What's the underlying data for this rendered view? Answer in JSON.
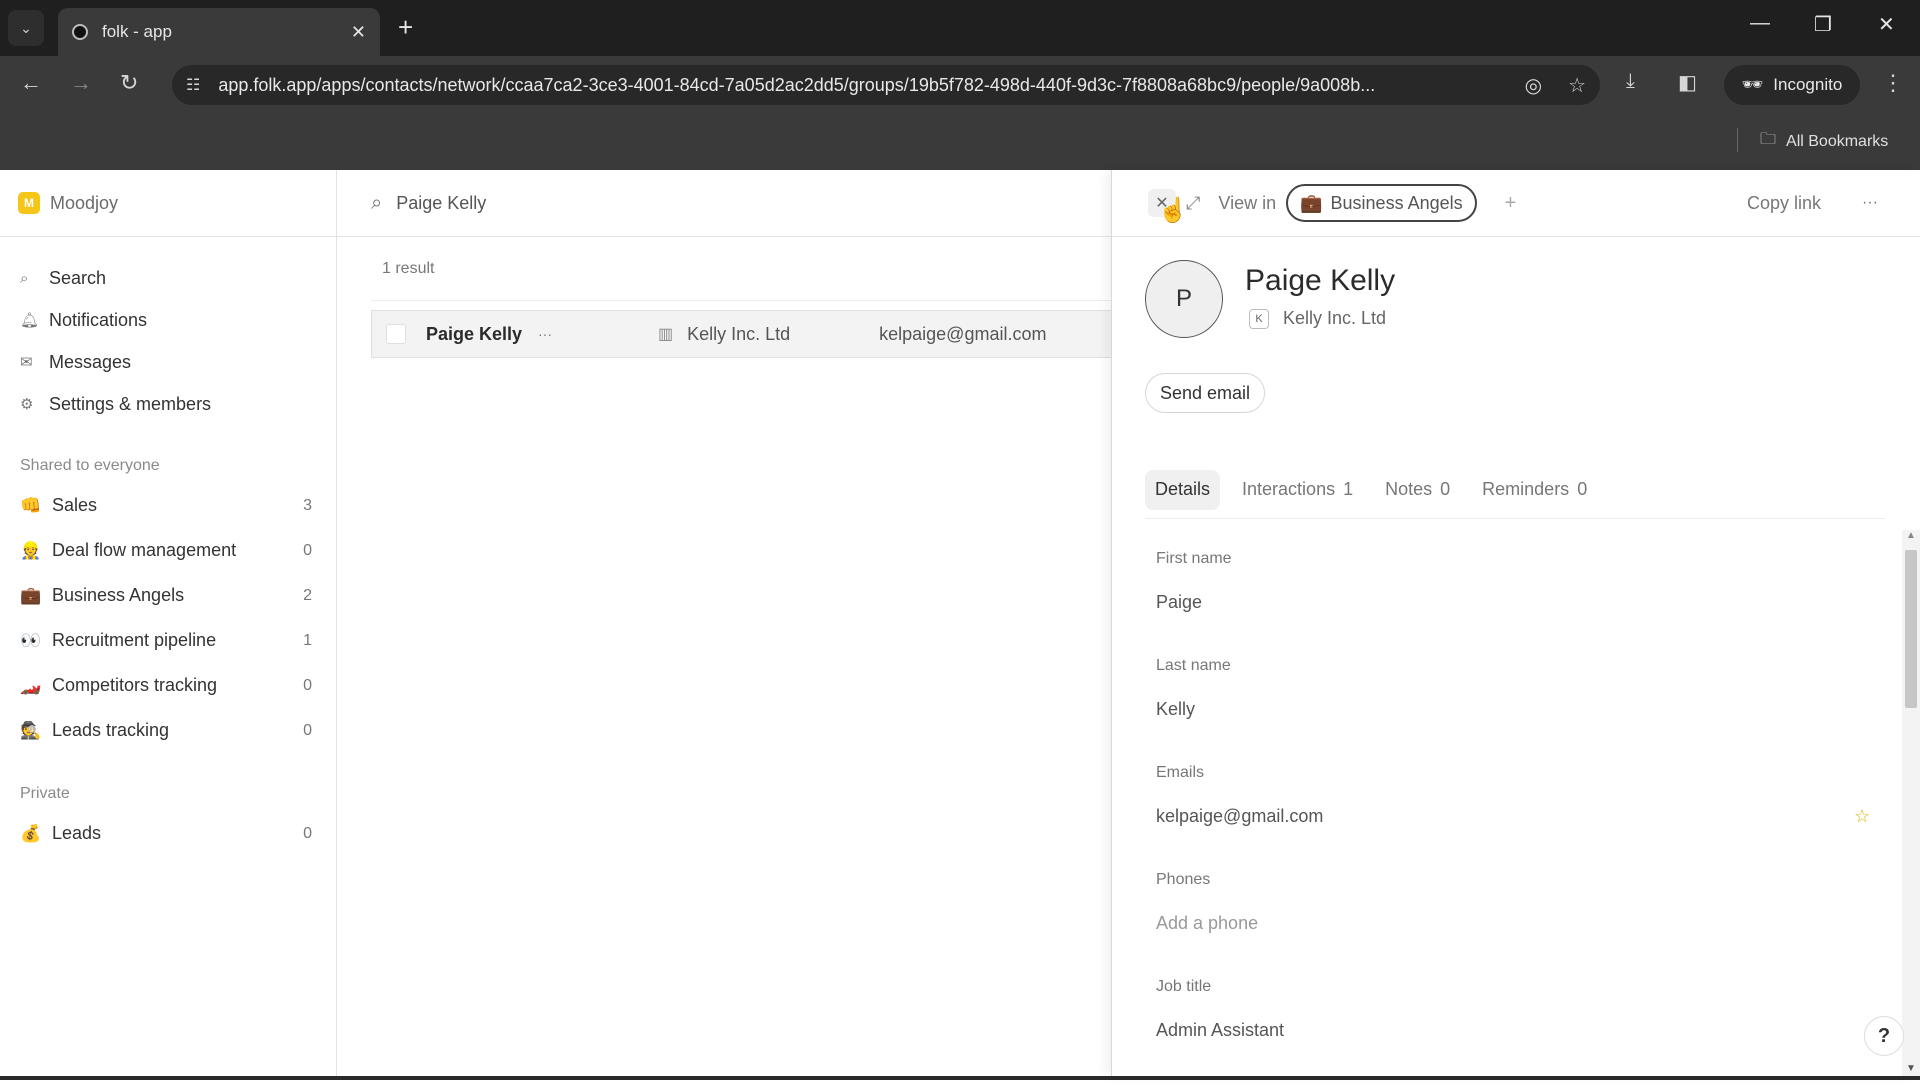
{
  "browser": {
    "tab_title": "folk - app",
    "url": "app.folk.app/apps/contacts/network/ccaa7ca2-3ce3-4001-84cd-7a05d2ac2dd5/groups/19b5f782-498d-440f-9d3c-7f8808a68bc9/people/9a008b...",
    "incognito_label": "Incognito",
    "all_bookmarks_label": "All Bookmarks"
  },
  "sidebar": {
    "workspace_initial": "M",
    "workspace_name": "Moodjoy",
    "nav": [
      {
        "label": "Search",
        "icon": "search-icon"
      },
      {
        "label": "Notifications",
        "icon": "bell-icon"
      },
      {
        "label": "Messages",
        "icon": "mail-icon"
      },
      {
        "label": "Settings & members",
        "icon": "gear-icon"
      }
    ],
    "shared_label": "Shared to everyone",
    "shared_groups": [
      {
        "emoji": "👊",
        "label": "Sales",
        "count": "3"
      },
      {
        "emoji": "👷",
        "label": "Deal flow management",
        "count": "0"
      },
      {
        "emoji": "💼",
        "label": "Business Angels",
        "count": "2"
      },
      {
        "emoji": "👀",
        "label": "Recruitment pipeline",
        "count": "1"
      },
      {
        "emoji": "🏎️",
        "label": "Competitors tracking",
        "count": "0"
      },
      {
        "emoji": "🕵️",
        "label": "Leads tracking",
        "count": "0"
      }
    ],
    "private_label": "Private",
    "private_groups": [
      {
        "emoji": "💰",
        "label": "Leads",
        "count": "0"
      }
    ]
  },
  "search": {
    "query": "Paige Kelly",
    "result_count": "1 result",
    "results": [
      {
        "name": "Paige Kelly",
        "company": "Kelly Inc. Ltd",
        "email": "kelpaige@gmail.com"
      }
    ]
  },
  "panel": {
    "view_in_label": "View in",
    "group_chip_emoji": "💼",
    "group_chip_label": "Business Angels",
    "copy_link_label": "Copy link",
    "avatar_initial": "P",
    "name": "Paige Kelly",
    "company_initial": "K",
    "company": "Kelly Inc. Ltd",
    "send_email_label": "Send email",
    "tabs": [
      {
        "label": "Details",
        "count": ""
      },
      {
        "label": "Interactions",
        "count": "1"
      },
      {
        "label": "Notes",
        "count": "0"
      },
      {
        "label": "Reminders",
        "count": "0"
      }
    ],
    "fields": {
      "first_name_label": "First name",
      "first_name": "Paige",
      "last_name_label": "Last name",
      "last_name": "Kelly",
      "emails_label": "Emails",
      "email": "kelpaige@gmail.com",
      "phones_label": "Phones",
      "phone_placeholder": "Add a phone",
      "job_title_label": "Job title",
      "job_title": "Admin Assistant"
    },
    "help_label": "?"
  }
}
